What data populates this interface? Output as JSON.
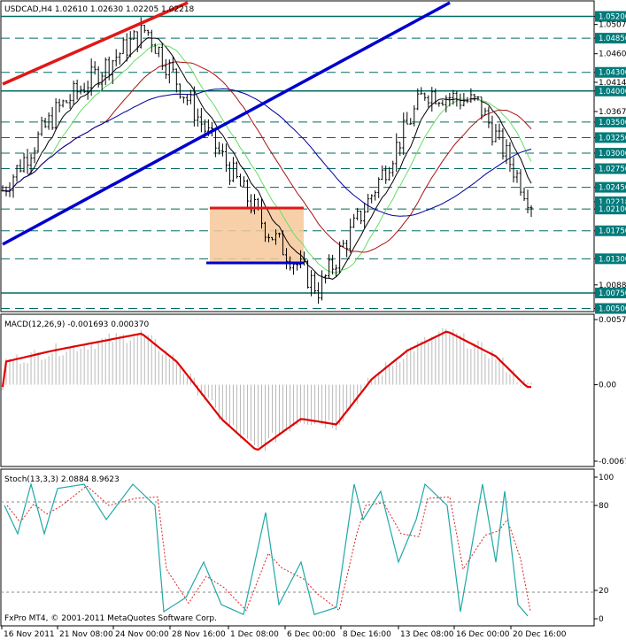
{
  "header": {
    "symbol_info": "USDCAD,H4  1.02610 1.02630 1.02205 1.02218"
  },
  "main_axis": {
    "labels": [
      {
        "text": "1.05200",
        "value": 1.052,
        "tag": true
      },
      {
        "text": "1.05070",
        "value": 1.0507,
        "tag": false
      },
      {
        "text": "1.04850",
        "value": 1.0485,
        "tag": true
      },
      {
        "text": "1.04600",
        "value": 1.046,
        "tag": false
      },
      {
        "text": "1.04300",
        "value": 1.043,
        "tag": true
      },
      {
        "text": "1.04140",
        "value": 1.0414,
        "tag": false
      },
      {
        "text": "1.04000",
        "value": 1.04,
        "tag": true
      },
      {
        "text": "1.03670",
        "value": 1.0367,
        "tag": false
      },
      {
        "text": "1.03500",
        "value": 1.035,
        "tag": true
      },
      {
        "text": "1.03250",
        "value": 1.0325,
        "tag": true
      },
      {
        "text": "1.03000",
        "value": 1.03,
        "tag": true
      },
      {
        "text": "1.02750",
        "value": 1.0275,
        "tag": true
      },
      {
        "text": "1.02450",
        "value": 1.0245,
        "tag": true
      },
      {
        "text": "1.02218",
        "value": 1.02218,
        "tag": true
      },
      {
        "text": "1.02100",
        "value": 1.021,
        "tag": true
      },
      {
        "text": "1.01750",
        "value": 1.0175,
        "tag": true
      },
      {
        "text": "1.01300",
        "value": 1.013,
        "tag": true
      },
      {
        "text": "1.00880",
        "value": 1.0088,
        "tag": false
      },
      {
        "text": "1.00750",
        "value": 1.0075,
        "tag": true
      },
      {
        "text": "1.00500",
        "value": 1.005,
        "tag": true
      }
    ]
  },
  "x_axis_labels": [
    "16 Nov 2011",
    "21 Nov 08:00",
    "24 Nov 00:00",
    "28 Nov 16:00",
    "1 Dec 08:00",
    "6 Dec 00:00",
    "8 Dec 16:00",
    "13 Dec 08:00",
    "16 Dec 00:00",
    "20 Dec 16:00"
  ],
  "macd": {
    "header": "MACD(12,26,9) -0.001693 0.000370",
    "axis_labels": [
      "0.00573",
      "0.00",
      "-0.00673"
    ]
  },
  "stoch": {
    "header": "Stoch(13,3,3) 2.0884 8.9623",
    "axis_labels": [
      "100",
      "80",
      "20",
      "0"
    ]
  },
  "footer": {
    "copyright": "FxPro MT4, © 2001-2011 MetaQuotes Software Corp."
  },
  "colors": {
    "tag_bg": "#007a7a",
    "level_line": "#006b5f",
    "bull_trend": "#0000cc",
    "bear_trend": "#e01818",
    "ma_black": "#000000",
    "ma_green": "#66dd66",
    "ma_red": "#aa1111",
    "ma_navy": "#000099",
    "box_fill": "#f6c89a",
    "macd_line": "#e00000",
    "macd_hist": "#b8b8b8",
    "stoch_main": "#20a8a8",
    "stoch_signal": "#dd2222"
  },
  "chart_data": {
    "type": "line",
    "title": "USDCAD,H4",
    "ohlc_last": {
      "open": 1.0261,
      "high": 1.0263,
      "low": 1.02205,
      "close": 1.02218
    },
    "close_path": {
      "x": [
        "16 Nov 2011",
        "21 Nov 08:00",
        "24 Nov 00:00",
        "28 Nov 16:00",
        "1 Dec 08:00",
        "6 Dec 00:00",
        "8 Dec 16:00",
        "13 Dec 08:00",
        "16 Dec 00:00",
        "20 Dec 16:00"
      ],
      "y": [
        1.024,
        1.037,
        1.05,
        1.033,
        1.018,
        1.008,
        1.022,
        1.04,
        1.038,
        1.02218
      ]
    },
    "horizontal_levels": [
      1.052,
      1.0485,
      1.043,
      1.04,
      1.035,
      1.0325,
      1.03,
      1.0275,
      1.0245,
      1.021,
      1.0175,
      1.013,
      1.0075,
      1.005
    ],
    "ylim": [
      1.0045,
      1.0545
    ],
    "macd": {
      "name": "MACD(12,26,9)",
      "main": -0.001693,
      "signal": 0.00037,
      "ylim": [
        -0.00673,
        0.00573
      ]
    },
    "stochastic": {
      "name": "Stoch(13,3,3)",
      "k": 2.0884,
      "d": 8.9623,
      "ylim": [
        0,
        100
      ],
      "levels": [
        20,
        80
      ]
    }
  }
}
